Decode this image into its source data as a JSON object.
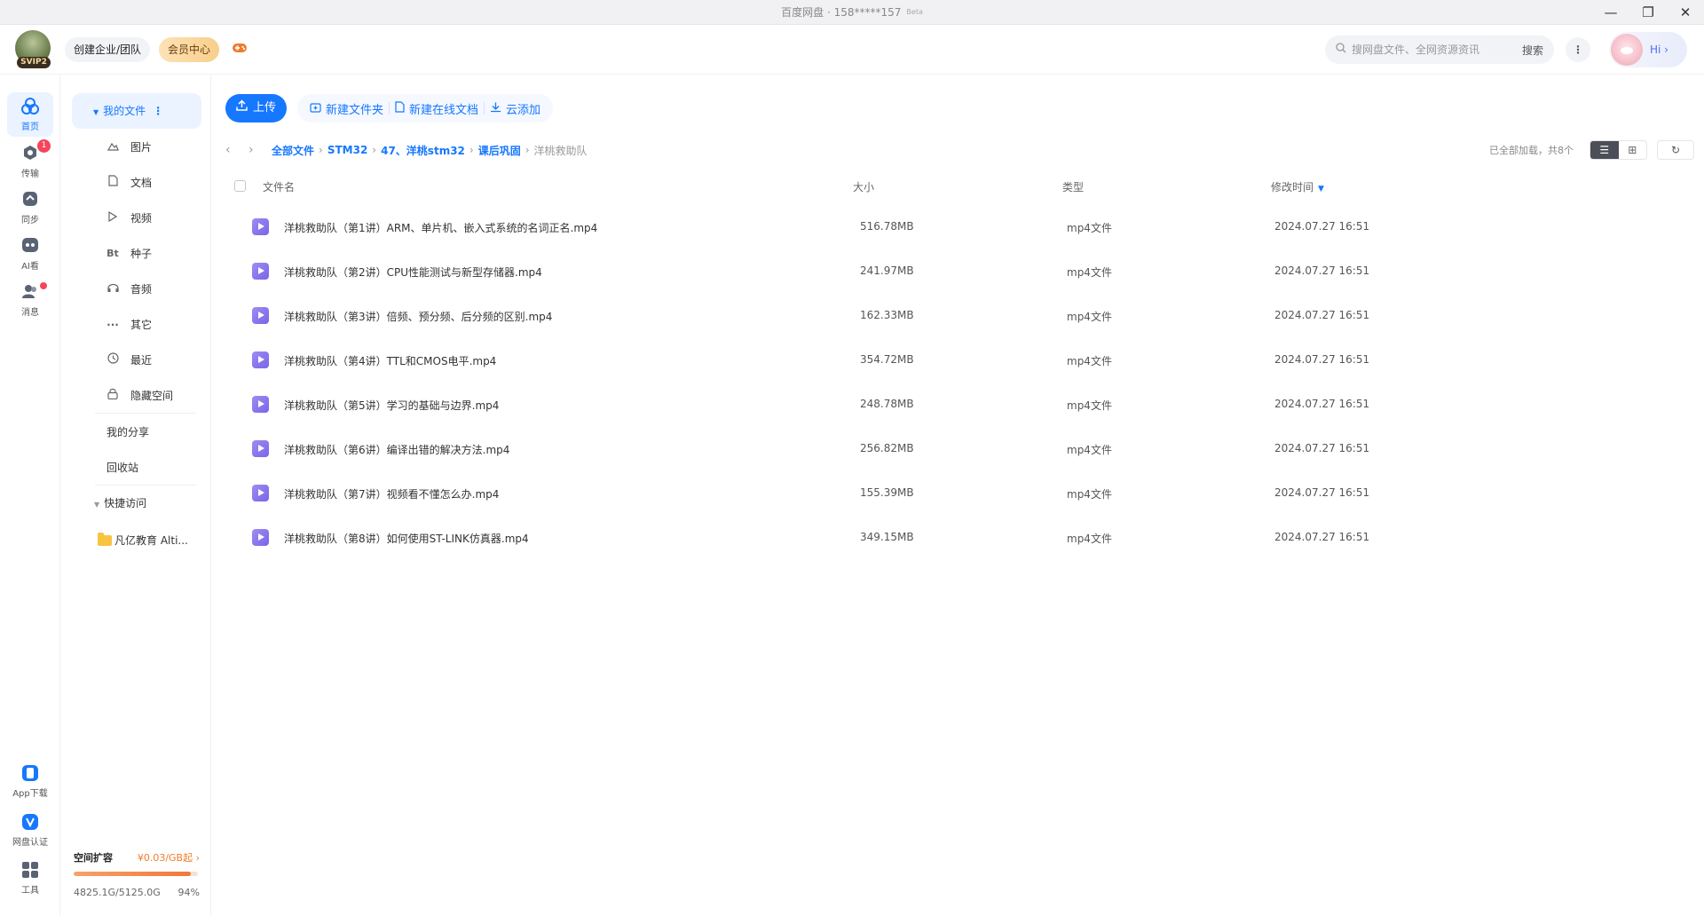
{
  "window": {
    "title": "百度网盘 · 158*****157",
    "beta": "Beta",
    "controls": [
      "—",
      "❐",
      "✕"
    ]
  },
  "header": {
    "svip": "SVIP2",
    "team_button": "创建企业/团队",
    "vip_button": "会员中心",
    "search_placeholder": "搜网盘文件、全网资源资讯",
    "search_button": "搜索",
    "more": "⋮",
    "hi": "Hi ›"
  },
  "rail": {
    "items": [
      {
        "label": "首页",
        "icon": "home-icon"
      },
      {
        "label": "传输",
        "icon": "transfer-icon",
        "badge": "1"
      },
      {
        "label": "同步",
        "icon": "sync-icon"
      },
      {
        "label": "AI看",
        "icon": "ai-icon"
      },
      {
        "label": "消息",
        "icon": "message-icon"
      }
    ],
    "bottom": [
      {
        "label": "App下载",
        "icon": "app-download-icon"
      },
      {
        "label": "网盘认证",
        "icon": "verify-icon"
      },
      {
        "label": "工具",
        "icon": "tools-icon"
      }
    ]
  },
  "sidebar": {
    "my_files": "我的文件",
    "categories": [
      {
        "label": "图片",
        "icon": "image-icon"
      },
      {
        "label": "文档",
        "icon": "document-icon"
      },
      {
        "label": "视频",
        "icon": "video-icon"
      },
      {
        "label": "种子",
        "icon": "torrent-icon"
      },
      {
        "label": "音频",
        "icon": "audio-icon"
      },
      {
        "label": "其它",
        "icon": "other-icon"
      },
      {
        "label": "最近",
        "icon": "recent-icon"
      },
      {
        "label": "隐藏空间",
        "icon": "lock-icon"
      }
    ],
    "my_share": "我的分享",
    "recycle": "回收站",
    "quick_access": "快捷访问",
    "quick_items": [
      "凡亿教育 Alti..."
    ]
  },
  "storage": {
    "title": "空间扩容",
    "promo": "¥0.03/GB起 ›",
    "used": "4825.1G/5125.0G",
    "percent": "94%",
    "fill_fraction": 0.94
  },
  "toolbar": {
    "upload": "上传",
    "new_folder": "新建文件夹",
    "new_online_doc": "新建在线文档",
    "cloud_add": "云添加"
  },
  "breadcrumb": {
    "items": [
      "全部文件",
      "STM32",
      "47、洋桃stm32",
      "课后巩固"
    ],
    "current": "洋桃救助队"
  },
  "status": {
    "loaded": "已全部加载，共8个"
  },
  "table": {
    "headers": {
      "name": "文件名",
      "size": "大小",
      "type": "类型",
      "modified": "修改时间"
    },
    "rows": [
      {
        "name": "洋桃救助队（第1讲）ARM、单片机、嵌入式系统的名词正名.mp4",
        "size": "516.78MB",
        "type": "mp4文件",
        "modified": "2024.07.27 16:51"
      },
      {
        "name": "洋桃救助队（第2讲）CPU性能测试与新型存储器.mp4",
        "size": "241.97MB",
        "type": "mp4文件",
        "modified": "2024.07.27 16:51"
      },
      {
        "name": "洋桃救助队（第3讲）倍频、预分频、后分频的区别.mp4",
        "size": "162.33MB",
        "type": "mp4文件",
        "modified": "2024.07.27 16:51"
      },
      {
        "name": "洋桃救助队（第4讲）TTL和CMOS电平.mp4",
        "size": "354.72MB",
        "type": "mp4文件",
        "modified": "2024.07.27 16:51"
      },
      {
        "name": "洋桃救助队（第5讲）学习的基础与边界.mp4",
        "size": "248.78MB",
        "type": "mp4文件",
        "modified": "2024.07.27 16:51"
      },
      {
        "name": "洋桃救助队（第6讲）编译出错的解决方法.mp4",
        "size": "256.82MB",
        "type": "mp4文件",
        "modified": "2024.07.27 16:51"
      },
      {
        "name": "洋桃救助队（第7讲）视频看不懂怎么办.mp4",
        "size": "155.39MB",
        "type": "mp4文件",
        "modified": "2024.07.27 16:51"
      },
      {
        "name": "洋桃救助队（第8讲）如何使用ST-LINK仿真器.mp4",
        "size": "349.15MB",
        "type": "mp4文件",
        "modified": "2024.07.27 16:51"
      }
    ]
  }
}
